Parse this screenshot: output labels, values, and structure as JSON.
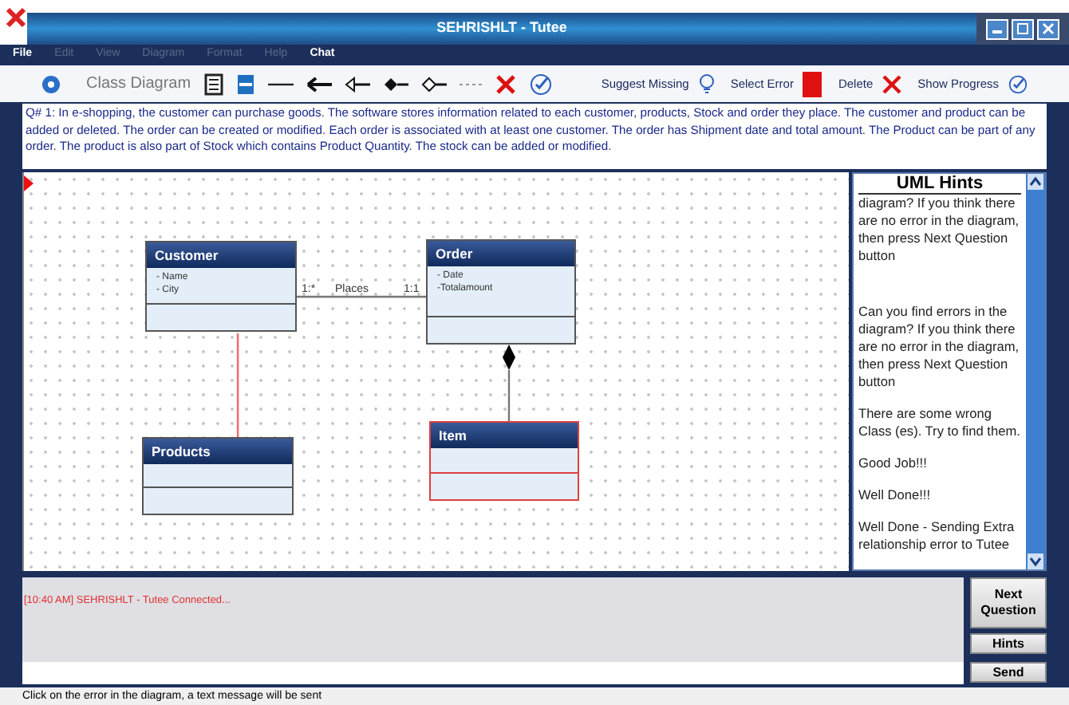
{
  "window": {
    "title": "SEHRISHLT - Tutee"
  },
  "menu": [
    {
      "label": "File",
      "disabled": false
    },
    {
      "label": "Edit",
      "disabled": true
    },
    {
      "label": "View",
      "disabled": true
    },
    {
      "label": "Diagram",
      "disabled": true
    },
    {
      "label": "Format",
      "disabled": true
    },
    {
      "label": "Help",
      "disabled": true
    },
    {
      "label": "Chat",
      "disabled": false
    }
  ],
  "toolbar": {
    "diagram_type": "Class Diagram",
    "actions": [
      "Suggest Missing",
      "Select Error",
      "Delete",
      "Show Progress"
    ]
  },
  "question": "Q# 1: In e-shopping, the customer can purchase goods. The software stores information related to each customer, products, Stock and order they place. The customer and product can be added or deleted. The order can be created or modified. Each order is associated with at least one customer. The order has Shipment date and total amount. The Product can be part of any order. The product is also part of Stock which contains Product Quantity. The stock can be added or modified.",
  "diagram": {
    "classes": [
      {
        "name": "Customer",
        "attributes": [
          "- Name",
          "- City"
        ],
        "error": false
      },
      {
        "name": "Order",
        "attributes": [
          "- Date",
          "-Totalamount"
        ],
        "error": false
      },
      {
        "name": "Item",
        "error": true
      },
      {
        "name": "Products",
        "error": false
      }
    ],
    "relations": [
      {
        "kind": "association",
        "label": "Places",
        "multiplicities": [
          "1:*",
          "1:1"
        ],
        "error": false
      },
      {
        "kind": "association",
        "error": true
      },
      {
        "kind": "composition",
        "error": false
      }
    ]
  },
  "hints": {
    "title": "UML Hints",
    "messages": [
      "diagram? If you think there are no error in the diagram, then press Next Question button",
      "Can you find errors in the diagram? If you think there are no error in the diagram, then press Next Question button",
      "There are some wrong Class (es). Try to find them.",
      "Good Job!!!",
      "Well Done!!!",
      "Well Done - Sending Extra relationship error to Tutee"
    ]
  },
  "chat": {
    "log": "[10:40 AM] SEHRISHLT - Tutee Connected...",
    "buttons": [
      "Next Question",
      "Hints",
      "Send"
    ]
  },
  "status_bar": "Click on the error in the diagram, a text message will be sent"
}
